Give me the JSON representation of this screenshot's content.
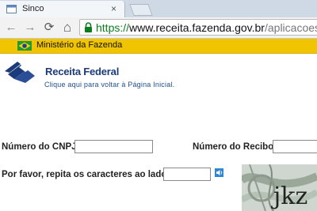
{
  "browser": {
    "tab_title": "Sinco",
    "tab_close_glyph": "×",
    "url_scheme": "https://",
    "url_host": "www.receita.fazenda.gov.br",
    "url_path": "/aplicacoes/ssl/a",
    "nav_icons": [
      "back-icon",
      "forward-icon",
      "reload-icon",
      "home-icon"
    ],
    "nav_glyphs": {
      "back": "←",
      "forward": "→",
      "reload": "⟳",
      "home": "⌂"
    }
  },
  "bookmarks": {
    "items": [
      {
        "label": "Ministério da Fazenda",
        "icon": "brazil-flag-icon"
      }
    ],
    "bar_color": "#f0c400"
  },
  "page": {
    "logo_text": "Receita Federal",
    "home_link": "Clique aqui para voltar à Página Inicial.",
    "form": {
      "cnpj_label": "Número do CNPJ:",
      "cnpj_value": "",
      "recibo_label": "Número do Recibo:",
      "recibo_value": "",
      "captcha_label": "Por favor, repita os caracteres ao lado:",
      "captcha_value": "",
      "captcha_text": "jkz"
    }
  },
  "colors": {
    "brand_blue": "#1a3a7a",
    "url_green": "#0a7d1c"
  }
}
